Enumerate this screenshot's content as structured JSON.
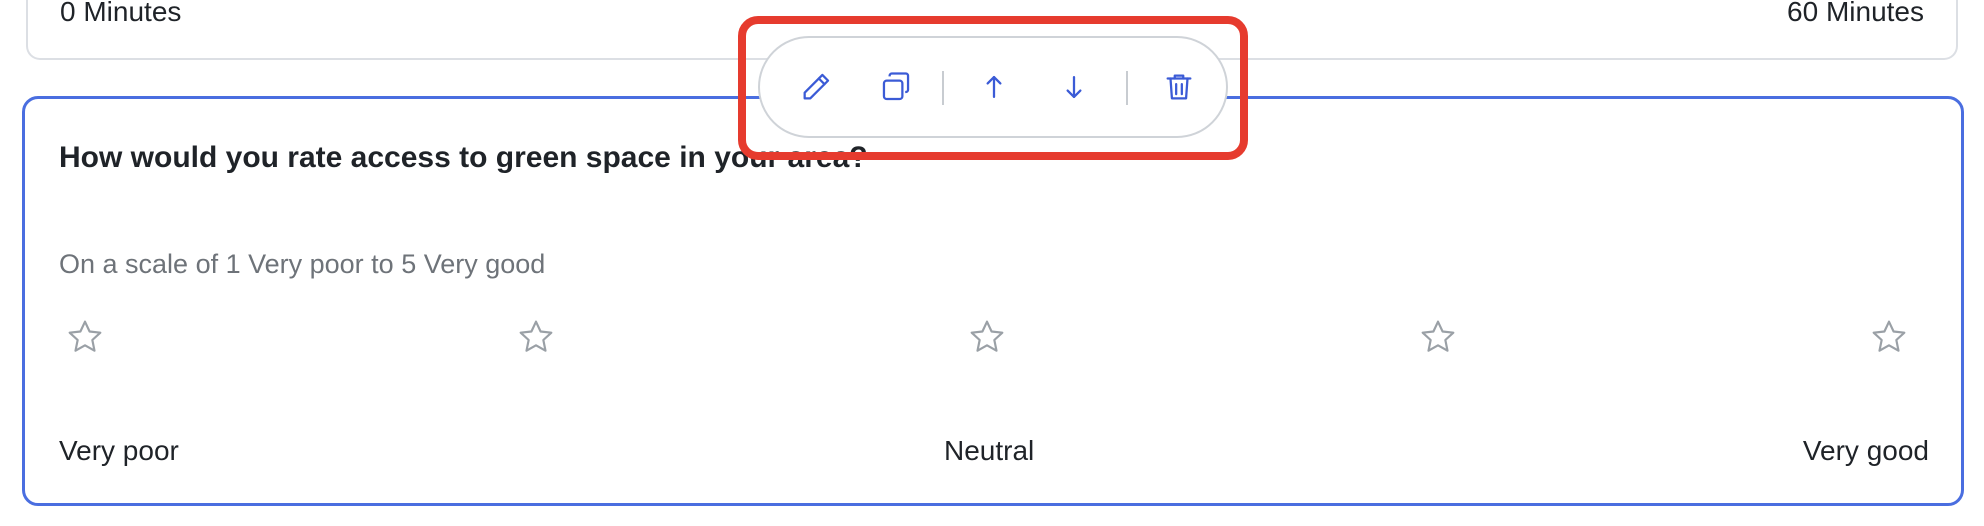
{
  "previous_question": {
    "min_label": "0 Minutes",
    "max_label": "60 Minutes"
  },
  "question_card": {
    "title": "How would you rate access to green space in your area?",
    "helper_text": "On a scale of 1 Very poor to 5 Very good",
    "rating": {
      "max": 5,
      "selected": 0,
      "star_icon": "star-outline-icon"
    },
    "scale_labels": {
      "low": "Very poor",
      "mid": "Neutral",
      "high": "Very good"
    }
  },
  "toolbar": {
    "actions": [
      "edit",
      "duplicate",
      "move-up",
      "move-down",
      "delete"
    ],
    "icons": [
      "pencil-icon",
      "copy-icon",
      "arrow-up-icon",
      "arrow-down-icon",
      "trash-icon"
    ]
  },
  "colors": {
    "accent": "#4a6ee0",
    "icon": "#3b5bd6",
    "highlight": "#e63b2e",
    "star_outline": "#9aa0a6",
    "border": "#dcdfe4"
  }
}
